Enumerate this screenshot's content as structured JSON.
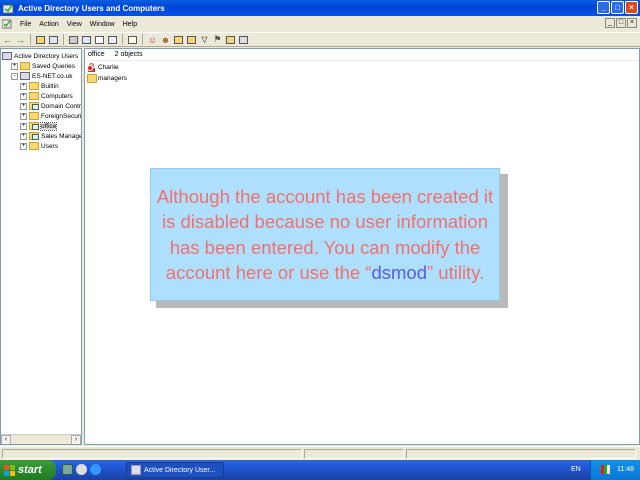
{
  "window": {
    "title": "Active Directory Users and Computers",
    "buttons": {
      "minimize": "_",
      "maximize": "□",
      "close": "×"
    }
  },
  "menubar": {
    "items": [
      "File",
      "Action",
      "View",
      "Window",
      "Help"
    ]
  },
  "tree": {
    "items": [
      {
        "label": "Active Directory Users",
        "depth": 0,
        "expander": "",
        "icon": "directory-root-icon"
      },
      {
        "label": "Saved Queries",
        "depth": 1,
        "expander": "+",
        "icon": "folder-icon"
      },
      {
        "label": "ES-NET.co.uk",
        "depth": 1,
        "expander": "-",
        "icon": "domain-icon"
      },
      {
        "label": "Builtin",
        "depth": 2,
        "expander": "+",
        "icon": "folder-icon"
      },
      {
        "label": "Computers",
        "depth": 2,
        "expander": "+",
        "icon": "folder-icon"
      },
      {
        "label": "Domain Contro",
        "depth": 2,
        "expander": "+",
        "icon": "ou-icon"
      },
      {
        "label": "ForeignSecurit",
        "depth": 2,
        "expander": "+",
        "icon": "folder-icon"
      },
      {
        "label": "office",
        "depth": 2,
        "expander": "+",
        "icon": "ou-icon",
        "selected": true
      },
      {
        "label": "Sales Manager",
        "depth": 2,
        "expander": "+",
        "icon": "ou-icon"
      },
      {
        "label": "Users",
        "depth": 2,
        "expander": "+",
        "icon": "folder-icon"
      }
    ]
  },
  "detail": {
    "container_name": "office",
    "object_count": "2 objects",
    "items": [
      {
        "label": "Charlie",
        "icon": "disabled-user-icon"
      },
      {
        "label": "managers",
        "icon": "group-icon"
      }
    ]
  },
  "callout": {
    "text_before": "Although the account has been created it is disabled because no user information has been entered. You can modify the account here or use the “",
    "command": "dsmod",
    "text_after": "” utility.",
    "colors": {
      "background": "#aee0fd",
      "text": "#f07070",
      "command": "#5a5ae0"
    }
  },
  "taskbar": {
    "start_label": "start",
    "task_label": "Active Directory User...",
    "language": "EN",
    "clock": "11:48"
  }
}
